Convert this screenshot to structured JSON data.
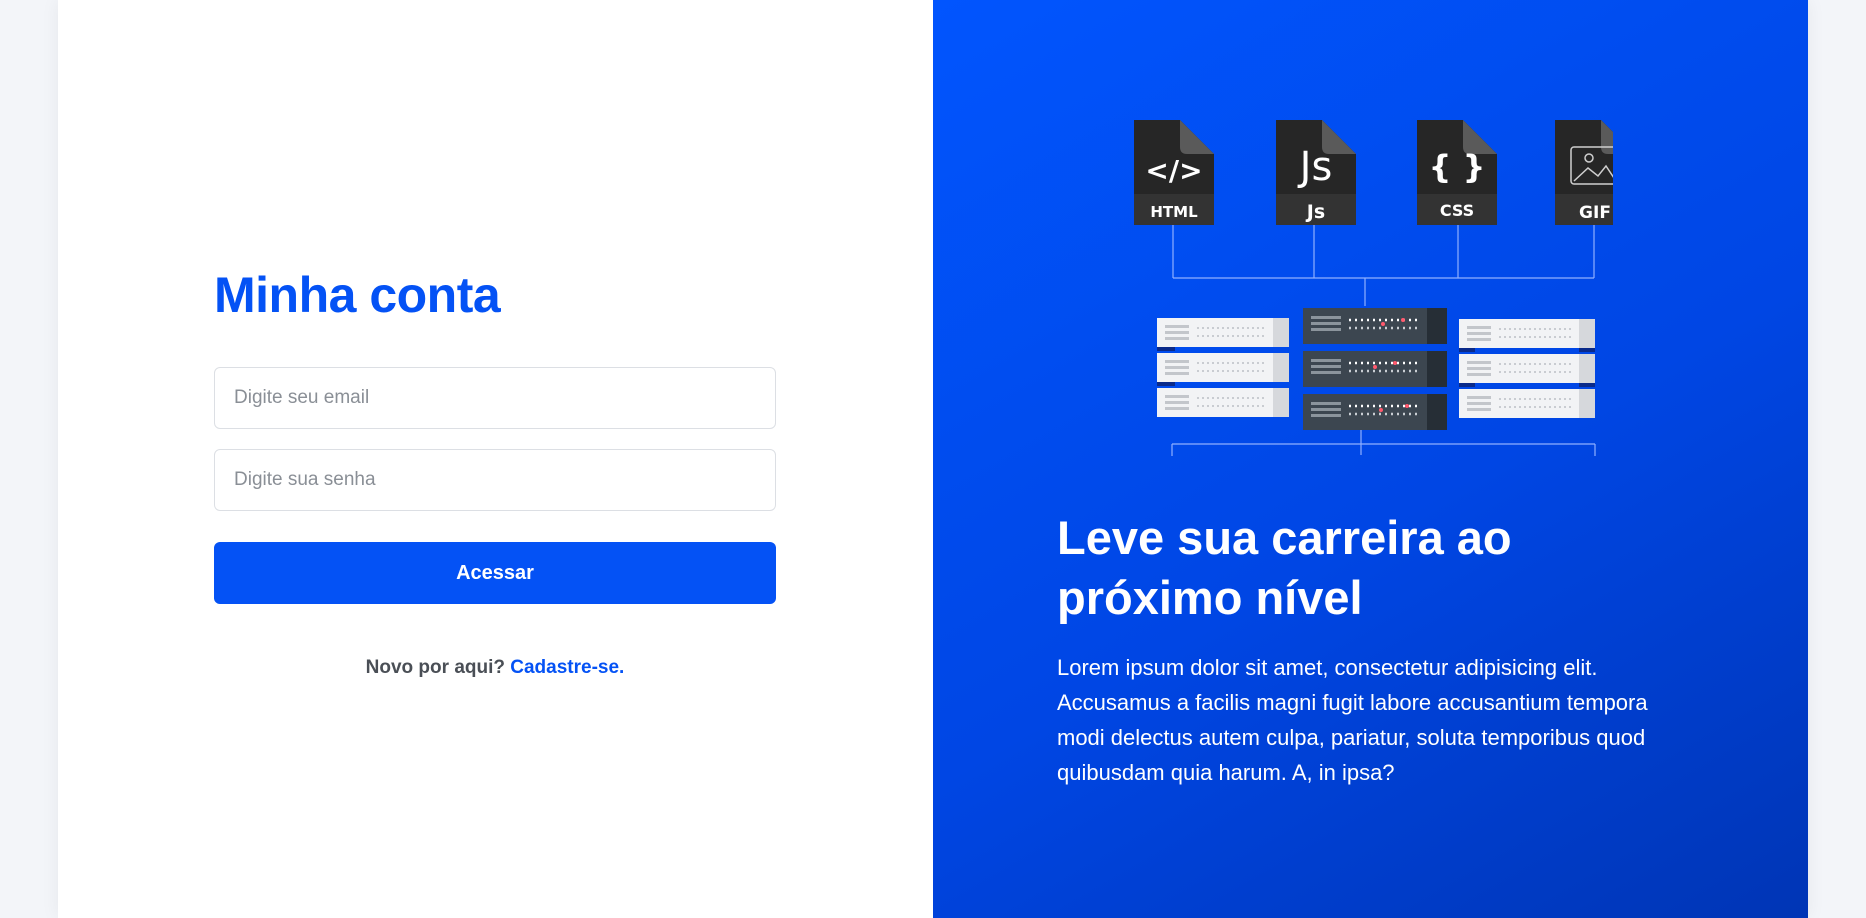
{
  "login": {
    "title": "Minha conta",
    "email_placeholder": "Digite seu email",
    "password_placeholder": "Digite sua senha",
    "submit_label": "Acessar",
    "signup_prompt": "Novo por aqui?",
    "signup_link": "Cadastre-se."
  },
  "hero": {
    "file_labels": [
      "HTML",
      "Js",
      "CSS",
      "GIF"
    ],
    "file_glyphs": [
      "</>",
      "Js",
      "{ }"
    ],
    "headline": "Leve sua carreira ao próximo nível",
    "description": "Lorem ipsum dolor sit amet, consectetur adipisicing elit. Accusamus a facilis magni fugit labore accusantium tempora modi delectus autem culpa, pariatur, soluta temporibus quod quibusdam quia harum. A, in ipsa?"
  },
  "colors": {
    "brand": "#0452f5",
    "panel_gradient_start": "#0155fe",
    "panel_gradient_end": "#0035b5"
  }
}
